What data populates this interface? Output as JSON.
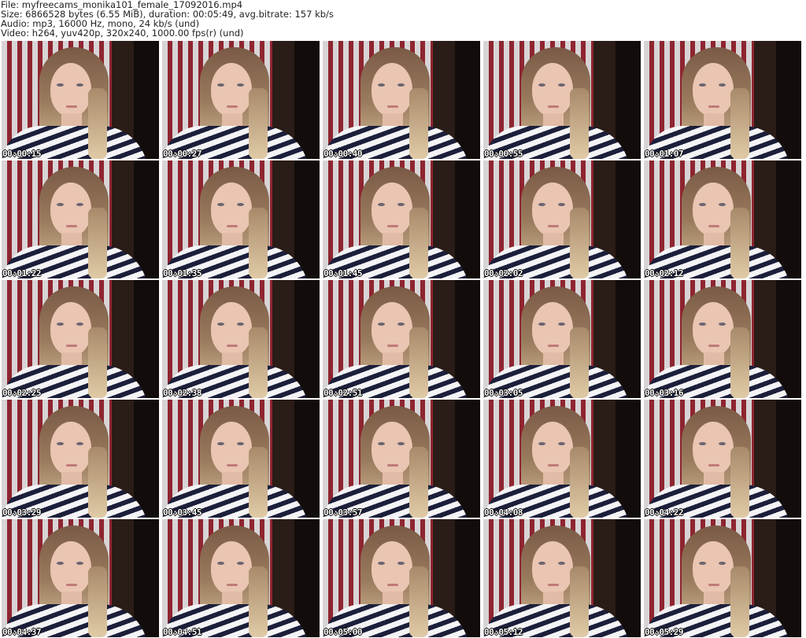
{
  "header": {
    "file": "File: myfreecams_monika101_female_17092016.mp4",
    "size": "Size: 6866528 bytes (6.55 MiB), duration: 00:05:49, avg.bitrate: 157 kb/s",
    "audio": "Audio: mp3, 16000 Hz, mono, 24 kb/s (und)",
    "video": "Video: h264, yuv420p, 320x240, 1000.00 fps(r) (und)"
  },
  "frames": [
    "00:00:15",
    "00:00:27",
    "00:00:40",
    "00:00:55",
    "00:01:07",
    "00:01:22",
    "00:01:35",
    "00:01:45",
    "00:02:02",
    "00:02:12",
    "00:02:25",
    "00:02:38",
    "00:02:51",
    "00:03:05",
    "00:03:16",
    "00:03:29",
    "00:03:45",
    "00:03:57",
    "00:04:08",
    "00:04:22",
    "00:04:37",
    "00:04:51",
    "00:05:00",
    "00:05:12",
    "00:05:29"
  ]
}
